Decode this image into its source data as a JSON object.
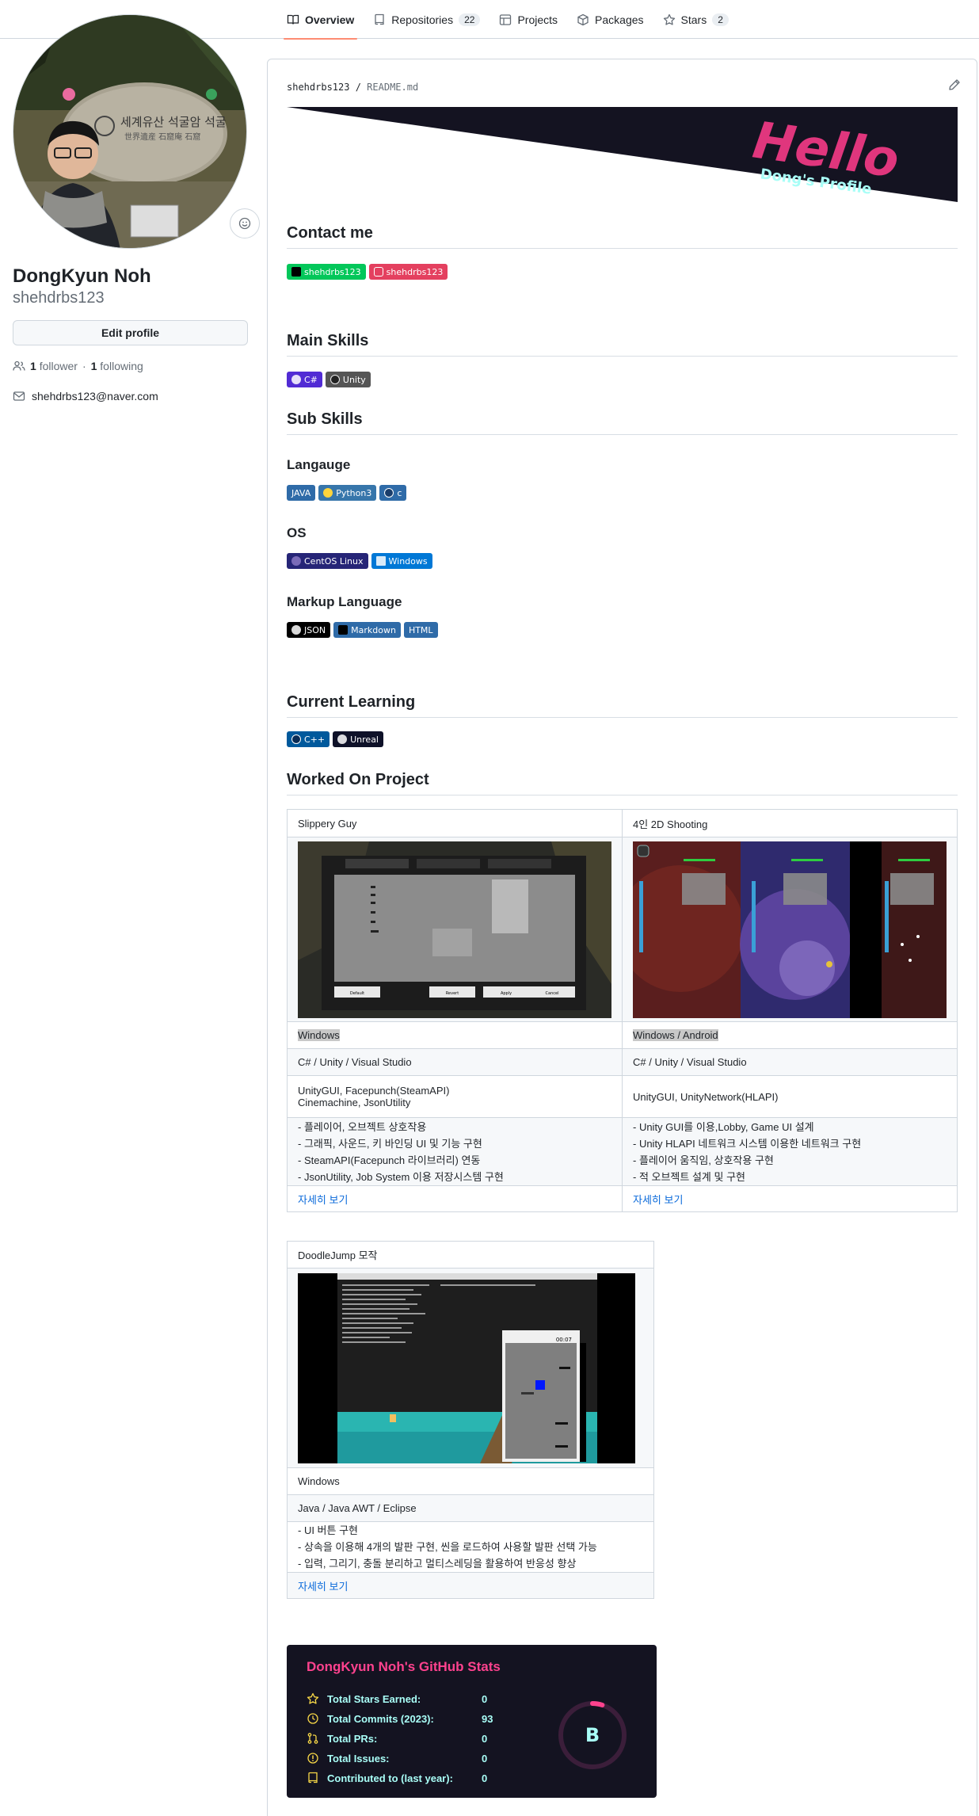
{
  "nav": {
    "tabs": [
      {
        "label": "Overview"
      },
      {
        "label": "Repositories",
        "count": "22"
      },
      {
        "label": "Projects"
      },
      {
        "label": "Packages"
      },
      {
        "label": "Stars",
        "count": "2"
      }
    ]
  },
  "profile": {
    "fullname": "DongKyun Noh",
    "username": "shehdrbs123",
    "edit_label": "Edit profile",
    "followers_count": "1",
    "followers_label": "follower",
    "following_count": "1",
    "following_label": "following",
    "email": "shehdrbs123@naver.com",
    "avatar_sign_lines": [
      "세계유산 석굴암 석굴",
      "世界遺産 石窟庵 石窟"
    ]
  },
  "readme": {
    "path_user": "shehdrbs123",
    "path_sep": " / ",
    "path_file": "README.md",
    "banner_title": "Hello",
    "banner_subtitle": "Dong's Profile",
    "contact_heading": "Contact me",
    "contact_badges": [
      {
        "label": "shehdrbs123",
        "color": "#03c75a"
      },
      {
        "label": "shehdrbs123",
        "color": "#e4405f"
      }
    ],
    "main_skills_heading": "Main Skills",
    "main_badges": [
      {
        "label": "C#",
        "color": "#512bd4"
      },
      {
        "label": "Unity",
        "color": "#555555"
      }
    ],
    "sub_skills_heading": "Sub Skills",
    "language_heading": "Langauge",
    "language_badges": [
      {
        "label": "JAVA",
        "color": "#2f6ba8"
      },
      {
        "label": "Python3",
        "color": "#3776ab"
      },
      {
        "label": "c",
        "color": "#2f6ba8"
      }
    ],
    "os_heading": "OS",
    "os_badges": [
      {
        "label": "CentOS Linux",
        "color": "#262577"
      },
      {
        "label": "Windows",
        "color": "#0078d6"
      }
    ],
    "markup_heading": "Markup Language",
    "markup_badges": [
      {
        "label": "JSON",
        "color": "#000000"
      },
      {
        "label": "Markdown",
        "color": "#2f6ba8"
      },
      {
        "label": "HTML",
        "color": "#2f6ba8"
      }
    ],
    "learning_heading": "Current Learning",
    "learning_badges": [
      {
        "label": "C++",
        "color": "#00599c"
      },
      {
        "label": "Unreal",
        "color": "#0e1128"
      }
    ],
    "projects_heading": "Worked On Project",
    "projects": [
      {
        "title": "Slippery Guy",
        "platform": "Windows",
        "stack": "C# / Unity / Visual Studio",
        "libs": [
          "UnityGUI, Facepunch(SteamAPI)",
          "Cinemachine, JsonUtility"
        ],
        "features": [
          "- 플레이어, 오브젝트 상호작용",
          "- 그래픽, 사운드, 키 바인딩 UI 및 기능 구현",
          "- SteamAPI(Facepunch 라이브러리) 연동",
          "- JsonUtility, Job System 이용 저장시스템 구현"
        ],
        "more": "자세히 보기"
      },
      {
        "title": "4인 2D Shooting",
        "platform": "Windows / Android",
        "stack": "C# / Unity / Visual Studio",
        "libs": [
          "UnityGUI, UnityNetwork(HLAPI)"
        ],
        "features": [
          "- Unity GUI를 이용,Lobby, Game UI 설계",
          "- Unity HLAPI 네트워크 시스템 이용한 네트워크 구현",
          "- 플레이어 움직임, 상호작용 구현",
          "- 적 오브젝트 설계 및 구현"
        ],
        "more": "자세히 보기"
      },
      {
        "title": "DoodleJump 모작",
        "platform": "Windows",
        "stack": "Java / Java AWT / Eclipse",
        "features": [
          "- UI 버튼 구현",
          "- 상속을 이용해 4개의 발판 구현, 씬을 로드하여 사용할 발판 선택 가능",
          "- 입력, 그리기, 충돌 분리하고 멀티스레딩을 활용하여 반응성 향상"
        ],
        "more": "자세히 보기"
      }
    ],
    "slippery_buttons": [
      "Default",
      "Revert",
      "Apply",
      "Cancel"
    ],
    "doodle_timer": "00:07",
    "stats": {
      "title": "DongKyun Noh's GitHub Stats",
      "rows": [
        {
          "label": "Total Stars Earned:",
          "value": "0",
          "icon": "star-icon"
        },
        {
          "label": "Total Commits (2023):",
          "value": "93",
          "icon": "history-icon"
        },
        {
          "label": "Total PRs:",
          "value": "0",
          "icon": "pull-request-icon"
        },
        {
          "label": "Total Issues:",
          "value": "0",
          "icon": "issue-icon"
        },
        {
          "label": "Contributed to (last year):",
          "value": "0",
          "icon": "repo-icon"
        }
      ],
      "rank": "B",
      "rank_progress": 0.05
    }
  },
  "colors": {
    "accent_tab": "#fd8c73",
    "link": "#0969da",
    "stats_bg": "#141321",
    "stats_title": "#fe428e",
    "stats_text": "#a9fef7"
  }
}
